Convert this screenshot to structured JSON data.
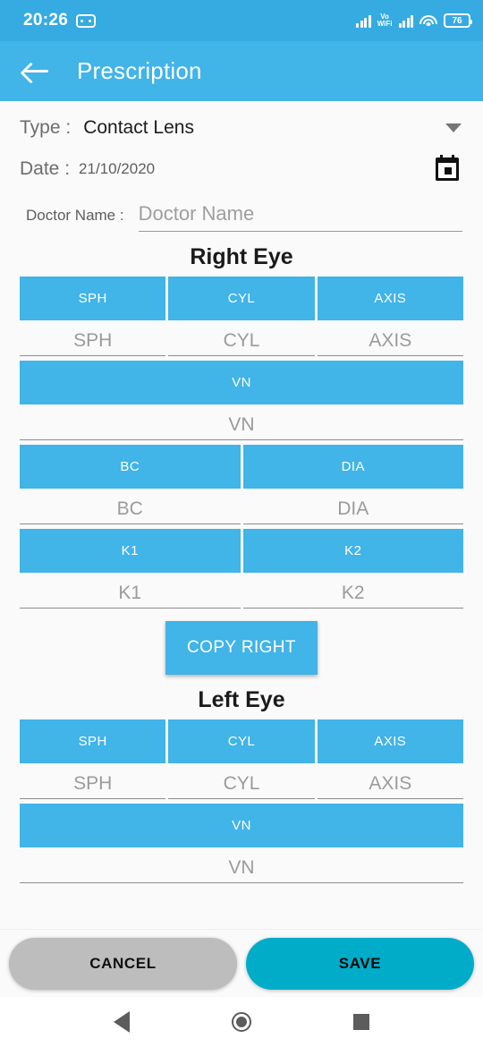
{
  "statusbar": {
    "time": "20:26",
    "note_icon": "message-icon",
    "signal_icon": "signal-bars-icon",
    "vowifi_line1": "Vo",
    "vowifi_line2": "WiFi",
    "signal2_icon": "signal-bars-icon",
    "wifi_icon": "wifi-icon",
    "battery_level": "76"
  },
  "appbar": {
    "back_icon": "back-arrow-icon",
    "title": "Prescription"
  },
  "form": {
    "type_label": "Type :",
    "type_value": "Contact Lens",
    "type_caret": "chevron-down-icon",
    "date_label": "Date :",
    "date_value": "21/10/2020",
    "calendar_icon": "calendar-icon",
    "doctor_label": "Doctor Name :",
    "doctor_placeholder": "Doctor Name",
    "doctor_value": ""
  },
  "right_eye": {
    "title": "Right Eye",
    "rows": [
      {
        "headers": [
          "SPH",
          "CYL",
          "AXIS"
        ],
        "placeholders": [
          "SPH",
          "CYL",
          "AXIS"
        ]
      },
      {
        "headers": [
          "VN"
        ],
        "placeholders": [
          "VN"
        ]
      },
      {
        "headers": [
          "BC",
          "DIA"
        ],
        "placeholders": [
          "BC",
          "DIA"
        ]
      },
      {
        "headers": [
          "K1",
          "K2"
        ],
        "placeholders": [
          "K1",
          "K2"
        ]
      }
    ],
    "copy_button": "COPY RIGHT"
  },
  "left_eye": {
    "title": "Left Eye",
    "rows": [
      {
        "headers": [
          "SPH",
          "CYL",
          "AXIS"
        ],
        "placeholders": [
          "SPH",
          "CYL",
          "AXIS"
        ]
      },
      {
        "headers": [
          "VN"
        ],
        "placeholders": [
          "VN"
        ]
      }
    ]
  },
  "actions": {
    "cancel_label": "CANCEL",
    "save_label": "SAVE"
  },
  "navbar": {
    "back_icon": "nav-back-icon",
    "home_icon": "nav-home-icon",
    "recents_icon": "nav-recents-icon"
  },
  "colors": {
    "status_bar": "#35ABE2",
    "app_bar": "#41B4E8",
    "header_cell": "#41B4E8",
    "save": "#00ACC8",
    "cancel": "#BDBDBD",
    "page_bg": "#FAFAFA"
  }
}
